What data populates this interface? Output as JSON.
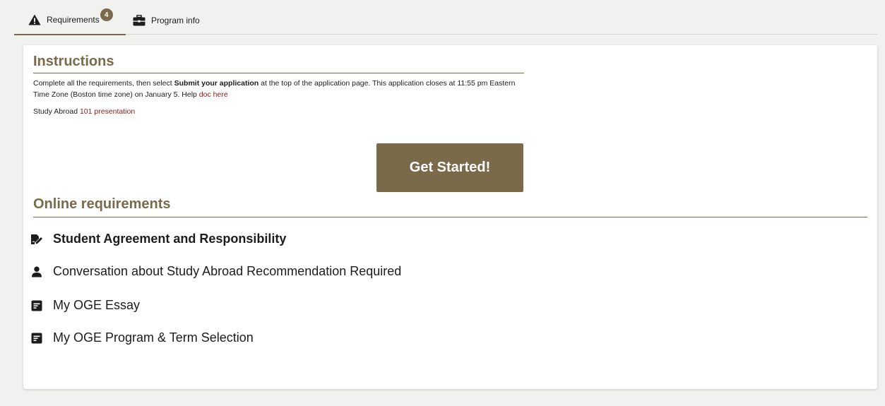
{
  "tabs": [
    {
      "label": "Requirements",
      "badge": "4",
      "icon": "warning-triangle-icon",
      "active": true
    },
    {
      "label": "Program info",
      "icon": "briefcase-icon",
      "active": false
    }
  ],
  "instructions": {
    "heading": "Instructions",
    "text_before": "Complete all the requirements, then select ",
    "text_bold": "Submit your application",
    "text_after": " at the top of the application page. This application closes at 11:55 pm Eastern Time Zone (Boston time zone) on January 5. Help ",
    "help_link": "doc here",
    "presentation_prefix": "Study Abroad ",
    "presentation_link": "101 presentation"
  },
  "get_started_label": "Get Started!",
  "online": {
    "heading": "Online requirements",
    "items": [
      {
        "label": "Student Agreement and Responsibility",
        "icon": "signature-icon"
      },
      {
        "label": "Conversation about Study Abroad Recommendation Required",
        "icon": "user-icon"
      },
      {
        "label": "My OGE Essay",
        "icon": "form-icon"
      },
      {
        "label": "My OGE Program & Term Selection",
        "icon": "form-icon"
      }
    ]
  },
  "colors": {
    "accent": "#7b6a4a",
    "link": "#8b1d1d",
    "background": "#f1f1ef"
  }
}
